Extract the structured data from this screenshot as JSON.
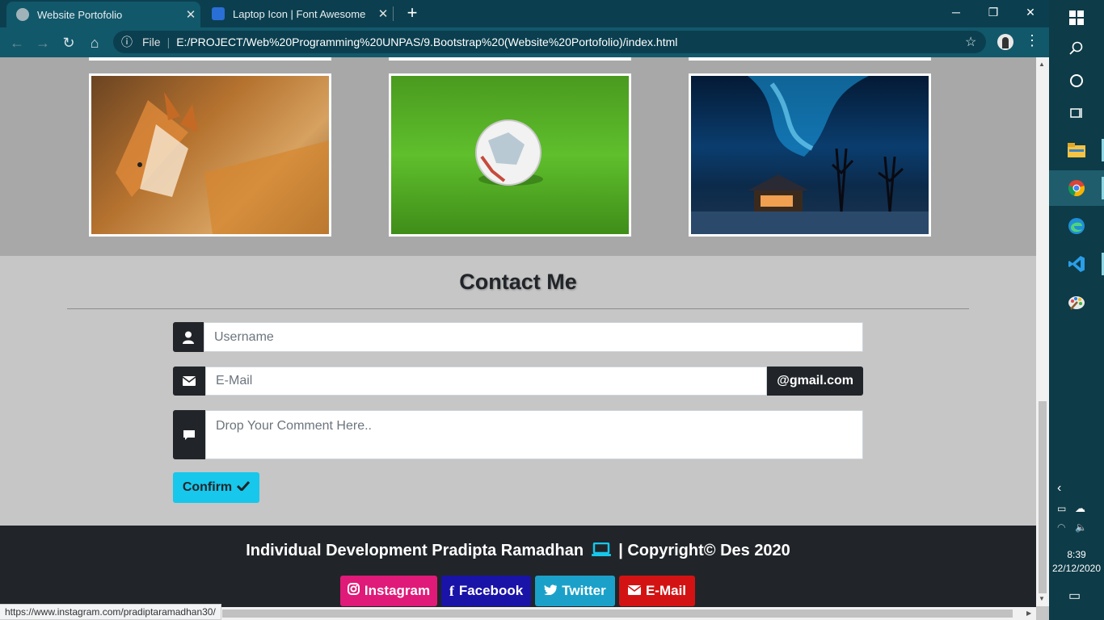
{
  "browser": {
    "tabs": [
      {
        "title": "Website Portofolio",
        "active": true
      },
      {
        "title": "Laptop Icon | Font Awesome",
        "active": false
      }
    ],
    "new_tab_label": "+",
    "omnibox": {
      "scheme_label": "File",
      "url": "E:/PROJECT/Web%20Programming%20UNPAS/9.Bootstrap%20(Website%20Portofolio)/index.html"
    },
    "status_url": "https://www.instagram.com/pradiptaramadhan30/"
  },
  "page": {
    "gallery": [
      {
        "name": "fox",
        "colors": [
          "#8b5a2b",
          "#d98a3a",
          "#f2c27a"
        ]
      },
      {
        "name": "soccer-ball",
        "colors": [
          "#3f8f1e",
          "#5cb52a",
          "#f2f2f2"
        ]
      },
      {
        "name": "aurora-cabin",
        "colors": [
          "#062a4a",
          "#1b8fd6",
          "#e6a050"
        ]
      }
    ],
    "contact": {
      "title": "Contact Me",
      "username_placeholder": "Username",
      "email_placeholder": "E-Mail",
      "email_suffix": "@gmail.com",
      "comment_placeholder": "Drop Your Comment Here..",
      "confirm_label": "Confirm"
    },
    "footer": {
      "text_before": "Individual Development Pradipta Ramadhan",
      "text_after": "| Copyright© Des 2020",
      "social": [
        {
          "label": "Instagram",
          "color": "#e01a78",
          "icon": "instagram-icon"
        },
        {
          "label": "Facebook",
          "color": "#1a13a8",
          "icon": "facebook-icon"
        },
        {
          "label": "Twitter",
          "color": "#1ba1c9",
          "icon": "twitter-icon"
        },
        {
          "label": "E-Mail",
          "color": "#d31313",
          "icon": "envelope-icon"
        }
      ]
    }
  },
  "taskbar": {
    "time": "8:39",
    "date": "22/12/2020"
  },
  "colors": {
    "accent_cyan": "#17c7ec",
    "dark": "#212529",
    "chrome_dark": "#0b3f4f",
    "chrome_toolbar": "#12586b"
  }
}
